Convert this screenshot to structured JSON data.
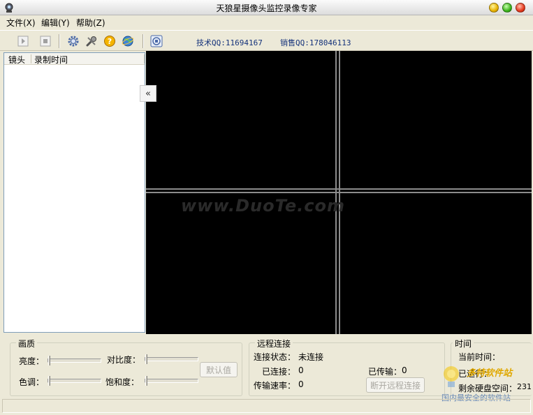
{
  "window": {
    "title": "天狼星摄像头监控录像专家"
  },
  "menu": [
    {
      "label": "文件(X)"
    },
    {
      "label": "编辑(Y)"
    },
    {
      "label": "帮助(Z)"
    }
  ],
  "toolbar": {
    "tech_qq": "技术QQ:11694167",
    "sales_qq": "销售QQ:178046113"
  },
  "list": {
    "columns": [
      "镜头",
      "录制时间"
    ]
  },
  "video": {
    "watermark": "www.DuoTe.com"
  },
  "picture": {
    "title": "画质",
    "brightness": "亮度：",
    "contrast": "对比度：",
    "hue": "色调：",
    "saturation": "饱和度：",
    "default_btn": "默认值"
  },
  "remote": {
    "title": "远程连接",
    "status_label": "连接状态：",
    "status_value": "未连接",
    "connected_label": "已连接：",
    "connected_value": "0",
    "transferred_label": "已传输：",
    "transferred_value": "0",
    "rate_label": "传输速率：",
    "rate_value": "0",
    "disconnect_btn": "断开远程连接"
  },
  "time": {
    "title": "时间",
    "current_label": "当前时间：",
    "running_label": "已运行：",
    "disk_label": "剩余硬盘空间：",
    "disk_value": "231"
  },
  "overlay_logo": {
    "text1": "多特软件站",
    "text2": "国内最安全的软件站"
  },
  "colors": {
    "qq_text": "#13317a",
    "video_bg": "#000000",
    "window_bg": "#ece9d8"
  }
}
